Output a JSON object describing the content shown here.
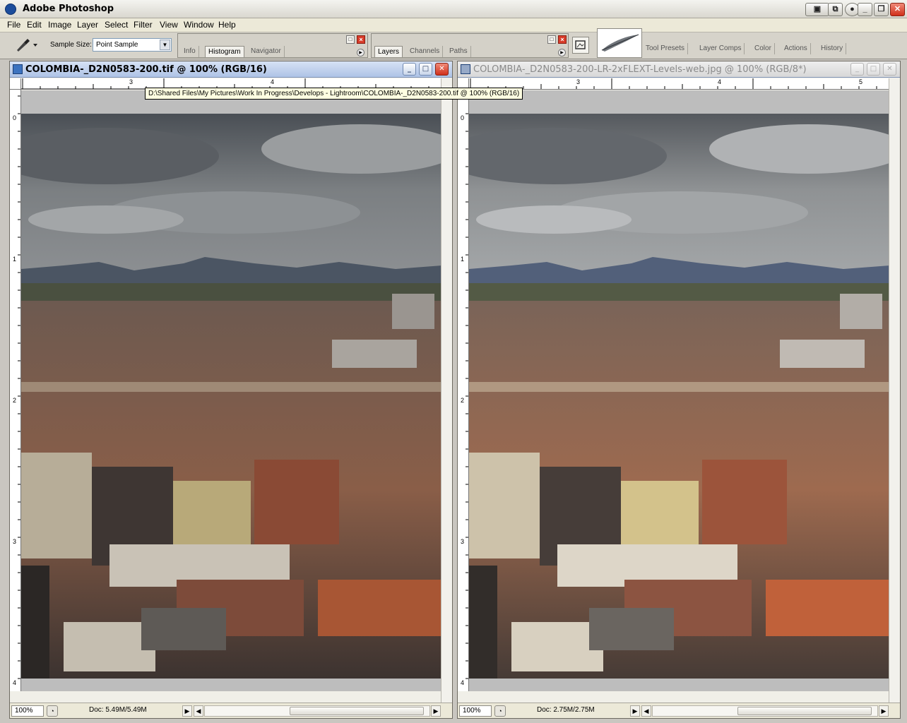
{
  "app": {
    "title": "Adobe Photoshop"
  },
  "menu": [
    "File",
    "Edit",
    "Image",
    "Layer",
    "Select",
    "Filter",
    "View",
    "Window",
    "Help"
  ],
  "options": {
    "sample_label": "Sample Size:",
    "sample_value": "Point Sample"
  },
  "palettes": {
    "info_group": [
      "Info",
      "Histogram",
      "Navigator"
    ],
    "layers_group": [
      "Layers",
      "Channels",
      "Paths"
    ],
    "well_tabs": [
      "Tool Presets",
      "Layer Comps",
      "Color",
      "Actions",
      "History"
    ]
  },
  "doc_left": {
    "title": "COLOMBIA-_D2N0583-200.tif @ 100% (RGB/16)",
    "zoom": "100%",
    "doc_size": "Doc: 5.49M/5.49M",
    "hruler": [
      "3",
      "4"
    ],
    "vruler": [
      "0",
      "1",
      "2",
      "3",
      "4"
    ]
  },
  "doc_right": {
    "title": "COLOMBIA-_D2N0583-200-LR-2xFLEXT-Levels-web.jpg @ 100% (RGB/8*)",
    "zoom": "100%",
    "doc_size": "Doc: 2.75M/2.75M",
    "hruler": [
      "3",
      "4",
      "5"
    ],
    "vruler": [
      "0",
      "1",
      "2",
      "3",
      "4"
    ]
  },
  "tooltip": "D:\\Shared Files\\My Pictures\\Work In Progress\\Develops - Lightroom\\COLOMBIA-_D2N0583-200.tif @ 100% (RGB/16)",
  "colors": {
    "active_title": "#aec3e6",
    "sky": "#6b6f73",
    "brick": "#8b4a34"
  }
}
